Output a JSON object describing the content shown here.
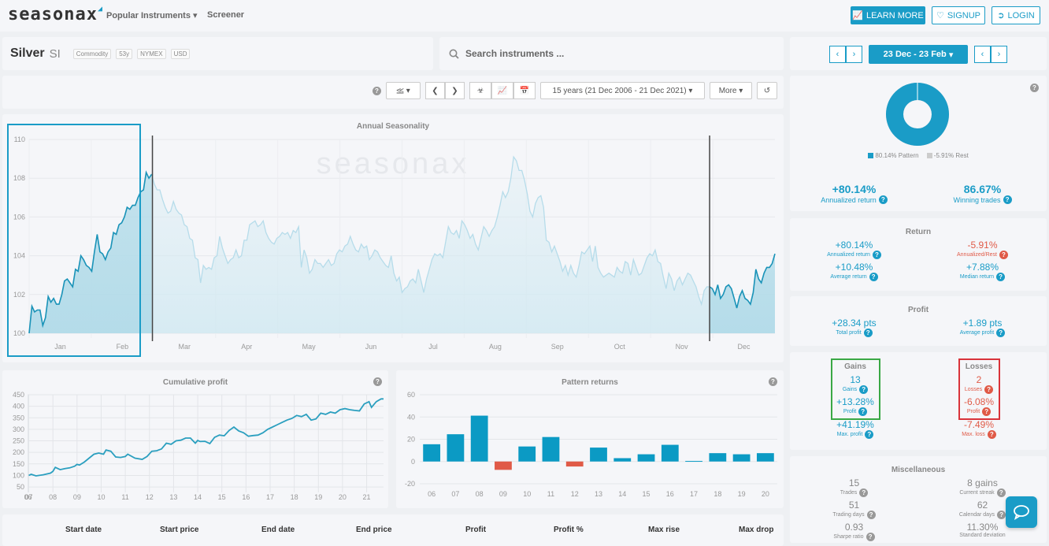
{
  "header": {
    "logo": "seasonax",
    "nav": [
      {
        "label": "Popular Instruments",
        "has_dropdown": true
      },
      {
        "label": "Screener"
      }
    ],
    "buttons": {
      "learn_more": "LEARN MORE",
      "signup": "SIGNUP",
      "login": "LOGIN"
    }
  },
  "instrument": {
    "name": "Silver",
    "symbol": "SI",
    "tags": [
      "Commodity",
      "53y",
      "NYMEX",
      "USD"
    ]
  },
  "search": {
    "placeholder": "Search instruments ..."
  },
  "date_range": {
    "label": "23 Dec - 23 Feb"
  },
  "toolbar": {
    "period": "15 years (21 Dec 2006 - 21 Dec 2021)",
    "more": "More"
  },
  "colors": {
    "accent": "#1a9cc7",
    "negative": "#e05a47",
    "gains_box": "#3aa845",
    "losses_box": "#d9333a"
  },
  "donut": {
    "pattern_share": 0.9985,
    "legend": [
      {
        "label": "80.14% Pattern",
        "color": "#1a9cc7"
      },
      {
        "label": "-5.91% Rest",
        "color": "#cccccc"
      }
    ]
  },
  "headline": {
    "annualized_return": "+80.14%",
    "annualized_return_label": "Annualized return",
    "winning_trades": "86.67%",
    "winning_trades_label": "Winning trades"
  },
  "return": {
    "title": "Return",
    "items": [
      {
        "value": "+80.14%",
        "label": "Annualized return",
        "tone": "pos"
      },
      {
        "value": "-5.91%",
        "label": "Annualized/Rest",
        "tone": "neg"
      },
      {
        "value": "+10.48%",
        "label": "Average return",
        "tone": "pos"
      },
      {
        "value": "+7.88%",
        "label": "Median return",
        "tone": "pos"
      }
    ]
  },
  "profit": {
    "title": "Profit",
    "items": [
      {
        "value": "+28.34 pts",
        "label": "Total profit"
      },
      {
        "value": "+1.89 pts",
        "label": "Average profit"
      }
    ]
  },
  "gains": {
    "title": "Gains",
    "count": "13",
    "count_label": "Gains",
    "profit": "+13.28%",
    "profit_label": "Profit",
    "max": "+41.19%",
    "max_label": "Max. profit"
  },
  "losses": {
    "title": "Losses",
    "count": "2",
    "count_label": "Losses",
    "profit": "-6.08%",
    "profit_label": "Profit",
    "max": "-7.49%",
    "max_label": "Max. loss"
  },
  "misc": {
    "title": "Miscellaneous",
    "items": [
      {
        "value": "15",
        "label": "Trades"
      },
      {
        "value": "8 gains",
        "label": "Current streak"
      },
      {
        "value": "51",
        "label": "Trading days"
      },
      {
        "value": "62",
        "label": "Calendar days"
      },
      {
        "value": "0.93",
        "label": "Sharpe ratio"
      },
      {
        "value": "11.30%",
        "label": "Standard deviation"
      }
    ]
  },
  "table": {
    "columns": [
      "Start date",
      "Start price",
      "End date",
      "End price",
      "Profit",
      "Profit %",
      "Max rise",
      "Max drop"
    ]
  },
  "chart_data": [
    {
      "type": "area",
      "title": "Annual Seasonality",
      "watermark": "seasonax",
      "x_labels": [
        "Jan",
        "Feb",
        "Mar",
        "Apr",
        "May",
        "Jun",
        "Jul",
        "Aug",
        "Sep",
        "Oct",
        "Nov",
        "Dec"
      ],
      "yticks": [
        100,
        102,
        104,
        106,
        108,
        110
      ],
      "ylim": [
        100,
        110
      ],
      "highlight": [
        "23 Dec",
        "23 Feb"
      ],
      "values": [
        100.0,
        101.4,
        101.1,
        101.2,
        101.2,
        100.4,
        100.8,
        101.9,
        101.6,
        101.8,
        101.5,
        101.5,
        102.0,
        102.7,
        102.8,
        102.6,
        102.4,
        103.3,
        103.2,
        104.0,
        103.8,
        103.5,
        103.4,
        103.2,
        104.2,
        105.1,
        104.2,
        104.1,
        103.8,
        104.2,
        104.4,
        105.2,
        105.1,
        105.6,
        105.7,
        106.0,
        106.5,
        106.4,
        106.6,
        106.6,
        107.0,
        107.3,
        107.4,
        108.3,
        108.0,
        108.2,
        107.7,
        107.4,
        107.4,
        106.9,
        106.5,
        106.2,
        106.3,
        106.8,
        106.4,
        106.2,
        106.1,
        105.6,
        105.5,
        104.9,
        104.8,
        103.9,
        103.8,
        102.6,
        103.5,
        103.3,
        103.4,
        103.3,
        103.9,
        104.0,
        105.0,
        104.4,
        104.0,
        103.6,
        103.8,
        103.9,
        104.3,
        103.9,
        104.0,
        104.8,
        104.8,
        105.6,
        105.7,
        105.8,
        105.5,
        105.6,
        105.8,
        105.2,
        104.9,
        104.7,
        104.6,
        104.9,
        105.0,
        105.2,
        105.1,
        105.2,
        104.9,
        105.3,
        105.2,
        105.5,
        103.4,
        104.3,
        103.9,
        103.1,
        103.3,
        103.8,
        103.6,
        103.6,
        103.4,
        103.6,
        103.8,
        103.5,
        103.6,
        104.1,
        104.3,
        104.2,
        104.5,
        104.6,
        105.0,
        104.6,
        104.3,
        104.2,
        104.6,
        104.4,
        104.5,
        103.8,
        104.0,
        104.3,
        104.2,
        103.9,
        103.7,
        103.5,
        103.4,
        104.0,
        103.1,
        102.7,
        102.9,
        102.1,
        102.3,
        102.4,
        102.7,
        102.8,
        102.6,
        103.3,
        102.7,
        102.1,
        102.8,
        103.3,
        103.8,
        104.1,
        104.0,
        104.1,
        103.9,
        104.7,
        105.5,
        105.2,
        105.1,
        105.3,
        104.9,
        105.8,
        105.6,
        105.3,
        104.9,
        105.1,
        104.6,
        104.3,
        104.9,
        105.5,
        105.3,
        105.0,
        105.3,
        105.5,
        106.0,
        106.6,
        107.3,
        107.0,
        107.3,
        108.0,
        109.1,
        108.9,
        108.4,
        108.4,
        107.9,
        107.2,
        106.3,
        106.0,
        106.7,
        107.0,
        107.1,
        106.5,
        104.8,
        104.7,
        104.2,
        104.5,
        104.1,
        103.7,
        103.2,
        103.5,
        103.0,
        103.5,
        103.1,
        102.9,
        103.5,
        104.2,
        104.1,
        104.3,
        104.5,
        103.7,
        104.5,
        103.4,
        103.1,
        102.9,
        103.0,
        103.1,
        103.0,
        102.9,
        103.4,
        103.2,
        103.1,
        103.7,
        103.6,
        103.0,
        103.8,
        103.4,
        103.0,
        103.1,
        103.5,
        103.9,
        104.1,
        104.0,
        104.3,
        103.7,
        103.6,
        102.9,
        102.3,
        103.1,
        102.8,
        102.2,
        102.7,
        102.9,
        102.5,
        102.8,
        103.1,
        103.0,
        102.7,
        102.4,
        101.9,
        101.5,
        102.2,
        102.4,
        102.4,
        102.3,
        102.0,
        102.5,
        101.8,
        102.0,
        102.4,
        102.5,
        102.3,
        101.8,
        101.3,
        101.9,
        102.2,
        101.8,
        101.7,
        101.5,
        102.1,
        103.3,
        102.8,
        102.6,
        103.1,
        103.4,
        103.4,
        103.6,
        104.1
      ],
      "highlight_start_index": 0,
      "highlight_end_index": 45,
      "highlight_tail_start_index": 250
    },
    {
      "type": "line",
      "title": "Cumulative profit",
      "x_labels": [
        "06",
        "07",
        "08",
        "09",
        "10",
        "11",
        "12",
        "13",
        "14",
        "15",
        "16",
        "17",
        "18",
        "19",
        "20",
        "21"
      ],
      "yticks": [
        50,
        100,
        150,
        200,
        250,
        300,
        350,
        400,
        450
      ],
      "ylim": [
        40,
        450
      ],
      "xlim": [
        6.95,
        21.7
      ],
      "x": [
        7.0,
        7.1,
        7.3,
        7.6,
        7.9,
        8.0,
        8.1,
        8.3,
        8.5,
        8.7,
        8.9,
        9.0,
        9.1,
        9.3,
        9.5,
        9.7,
        9.9,
        10.1,
        10.2,
        10.4,
        10.6,
        10.8,
        11.0,
        11.1,
        11.4,
        11.7,
        11.9,
        12.1,
        12.3,
        12.5,
        12.7,
        12.9,
        13.1,
        13.3,
        13.5,
        13.7,
        13.9,
        14.0,
        14.1,
        14.3,
        14.5,
        14.7,
        14.9,
        15.1,
        15.3,
        15.5,
        15.7,
        15.9,
        16.1,
        16.3,
        16.5,
        16.7,
        16.9,
        17.1,
        17.3,
        17.5,
        17.7,
        17.9,
        18.1,
        18.3,
        18.5,
        18.7,
        18.9,
        19.1,
        19.3,
        19.5,
        19.7,
        19.9,
        20.1,
        20.3,
        20.5,
        20.7,
        20.9,
        21.1,
        21.2,
        21.4,
        21.6,
        21.7
      ],
      "values": [
        100,
        105,
        98,
        103,
        110,
        118,
        135,
        125,
        130,
        133,
        140,
        148,
        145,
        158,
        175,
        192,
        197,
        192,
        210,
        205,
        180,
        178,
        182,
        192,
        175,
        170,
        182,
        205,
        207,
        215,
        240,
        235,
        250,
        253,
        262,
        262,
        240,
        252,
        247,
        248,
        238,
        265,
        275,
        272,
        295,
        310,
        293,
        285,
        270,
        273,
        275,
        285,
        300,
        310,
        320,
        330,
        340,
        347,
        360,
        355,
        365,
        340,
        345,
        370,
        365,
        375,
        370,
        385,
        390,
        385,
        382,
        380,
        410,
        420,
        395,
        420,
        432,
        432
      ]
    },
    {
      "type": "bar",
      "title": "Pattern returns",
      "categories": [
        "06",
        "07",
        "08",
        "09",
        "10",
        "11",
        "12",
        "13",
        "14",
        "15",
        "16",
        "17",
        "18",
        "19",
        "20"
      ],
      "values": [
        15.5,
        24.5,
        41.2,
        -7.5,
        13.5,
        22.0,
        -4.5,
        12.5,
        3.0,
        6.5,
        15.0,
        0.5,
        7.5,
        6.5,
        7.5
      ],
      "yticks": [
        -20,
        0,
        20,
        40,
        60
      ],
      "ylim": [
        -20,
        60
      ]
    }
  ]
}
